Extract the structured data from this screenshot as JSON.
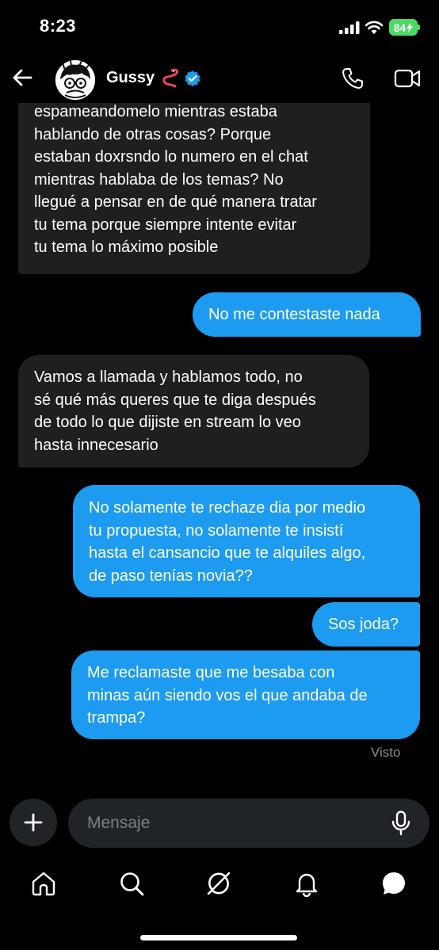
{
  "status_bar": {
    "time": "8:23",
    "battery": "84"
  },
  "header": {
    "contact_name": "Gussy",
    "back_icon": "arrow-left",
    "call_icon": "phone",
    "video_icon": "video-camera",
    "verified_color": "#1d9bf0"
  },
  "messages": [
    {
      "direction": "received",
      "text": "espameandomelo mientras estaba\nhablando de otras cosas? Porque\nestaban doxrsndo lo numero en el chat\nmientras hablaba de los temas? No\nllegué a pensar en de qué manera tratar\ntu tema porque siempre intente evitar\ntu tema lo máximo posible"
    },
    {
      "direction": "sent",
      "text": "No me contestaste nada"
    },
    {
      "direction": "received",
      "text": "Vamos a llamada y hablamos todo, no\nsé qué más queres que te diga después\nde todo lo que dijiste en stream lo veo\nhasta innecesario"
    },
    {
      "direction": "sent",
      "text": "No solamente te rechaze dia por medio\ntu propuesta, no solamente te insistí\nhasta el cansancio que te alquiles algo,\nde paso tenías novia??"
    },
    {
      "direction": "sent",
      "text": "Sos joda?"
    },
    {
      "direction": "sent",
      "text": "Me reclamaste que me besaba con\nminas aún siendo vos el que andaba de\ntrampa?"
    }
  ],
  "seen_label": "Visto",
  "composer": {
    "placeholder": "Mensaje",
    "value": ""
  },
  "nav": {
    "items": [
      "home-icon",
      "search-icon",
      "grok-icon",
      "notifications-icon",
      "messages-icon"
    ]
  },
  "colors": {
    "sent_bubble": "#1d9bf0",
    "received_bubble": "#1f1f1f",
    "background": "#000000",
    "battery": "#4cd964"
  }
}
